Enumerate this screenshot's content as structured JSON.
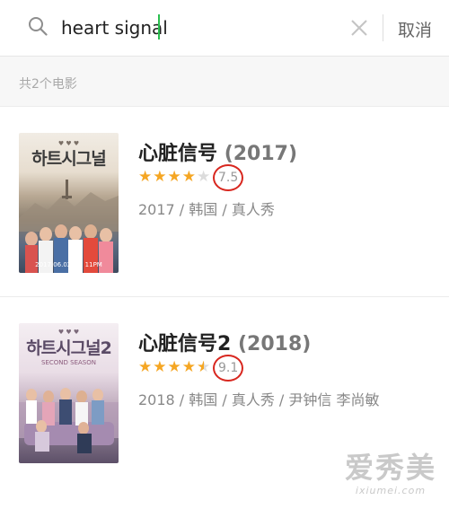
{
  "search": {
    "value": "heart signal",
    "cancel_label": "取消"
  },
  "results_count": "共2个电影",
  "results": [
    {
      "title": "心脏信号",
      "year": "(2017)",
      "rating": "7.5",
      "stars_filled": 4,
      "meta": "2017 / 韩国 / 真人秀",
      "poster_title": "하트시그널",
      "poster_caption": "2017.06.02 FRI 11PM"
    },
    {
      "title": "心脏信号2",
      "year": "(2018)",
      "rating": "9.1",
      "stars_filled": 4.5,
      "meta": "2018 / 韩国 / 真人秀 / 尹钟信 李尚敏",
      "poster_title": "하트시그널2",
      "poster_caption": "SECOND SEASON"
    }
  ],
  "watermark": {
    "logo": "爱秀美",
    "url": "ixiumei.com"
  },
  "colors": {
    "accent_star": "#f5a623",
    "rating_circle": "#d8271f",
    "caret": "#2bbf4f"
  }
}
